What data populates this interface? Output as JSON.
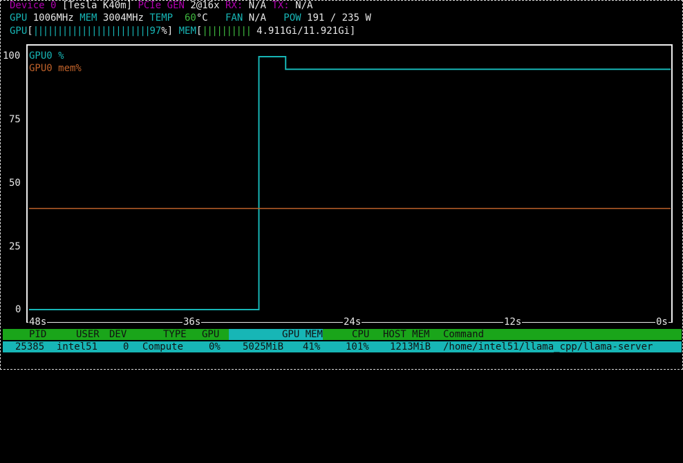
{
  "device": {
    "label": "Device",
    "index": "0",
    "name": "[Tesla K40m]",
    "pcie_label": "PCIe",
    "gen_label": "GEN",
    "gen_value": "2@16x",
    "rx_label": "RX:",
    "rx_value": "N/A",
    "tx_label": "TX:",
    "tx_value": "N/A"
  },
  "stats": {
    "gpu_label": "GPU",
    "gpu_clock": "1006MHz",
    "mem_label": "MEM",
    "mem_clock": "3004MHz",
    "temp_label": "TEMP",
    "temp_value": "60",
    "temp_unit": "°C",
    "fan_label": "FAN",
    "fan_value": "N/A",
    "pow_label": "POW",
    "pow_value": "191 / 235 W"
  },
  "bars": {
    "gpu_label": "GPU",
    "gpu_bar": "||||||||||||||||||||||||",
    "gpu_percent": "97",
    "gpu_percent_suffix": "%]",
    "mem_label": "MEM",
    "mem_bar": "||||||||||",
    "mem_text": "4.911Gi/11.921Gi]"
  },
  "colors": {
    "cyan": "#17b6b6",
    "orange": "#c0622a",
    "green": "#1aa51a",
    "magenta": "#b000b0"
  },
  "chart_data": {
    "type": "line",
    "x_labels": [
      "48s",
      "36s",
      "24s",
      "12s",
      "0s"
    ],
    "y_labels": [
      "100",
      "75",
      "50",
      "25",
      "0"
    ],
    "ylim": [
      0,
      100
    ],
    "xlim": [
      -48,
      0
    ],
    "series": [
      {
        "name": "GPU0 %",
        "color": "#17b6b6",
        "points": [
          [
            -48,
            0
          ],
          [
            -30.8,
            0
          ],
          [
            -30.8,
            100
          ],
          [
            -28.8,
            100
          ],
          [
            -28.8,
            95
          ],
          [
            0,
            95
          ]
        ]
      },
      {
        "name": "GPU0 mem%",
        "color": "#c0622a",
        "points": [
          [
            -48,
            40
          ],
          [
            0,
            40
          ]
        ]
      }
    ]
  },
  "process_table": {
    "headers": [
      "PID",
      "USER",
      "DEV",
      "TYPE",
      "GPU",
      "GPU MEM",
      "CPU",
      "HOST MEM",
      "Command"
    ],
    "rows": [
      [
        "25385",
        "intel51",
        "0",
        "Compute",
        "0%",
        "5025MiB",
        "41%",
        "101%",
        "1213MiB",
        "/home/intel51/llama_cpp/llama-server"
      ]
    ]
  }
}
